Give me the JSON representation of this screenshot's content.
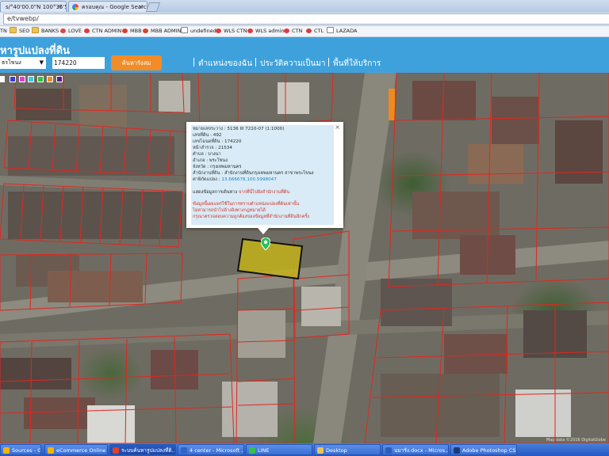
{
  "browser": {
    "tabs": [
      {
        "label": "s/°40'00.0\"N 100°35'59.3\"E"
      },
      {
        "label": "ครอบคุณ - Google Search"
      }
    ],
    "address": "e/tvwebp/"
  },
  "bookmarks": [
    {
      "label": "TN",
      "icon": "page-icon"
    },
    {
      "label": "SEO",
      "icon": "folder-icon"
    },
    {
      "label": "BANKS",
      "icon": "folder-icon"
    },
    {
      "label": "LOVE",
      "icon": "heart-icon"
    },
    {
      "label": "CTN ADMIN",
      "icon": "ctn-icon"
    },
    {
      "label": "MBB",
      "icon": "settings-icon"
    },
    {
      "label": "MBB ADMIN",
      "icon": "settings-icon"
    },
    {
      "label": "undefined",
      "icon": "page-icon"
    },
    {
      "label": "WLS CTN",
      "icon": "ctn-icon"
    },
    {
      "label": "WLS admin",
      "icon": "ctn-icon"
    },
    {
      "label": "CTN",
      "icon": "ctn-icon"
    },
    {
      "label": "CTL",
      "icon": "plane-icon"
    },
    {
      "label": "LAZADA",
      "icon": "page-icon"
    }
  ],
  "app": {
    "title": "หารูปแปลงที่ดิน",
    "province_value": "ธรโขนง",
    "parcel_value": "174220",
    "search_label": "ค้นหารังสม",
    "nav": [
      "ตำแหน่งของฉัน",
      "ประวัติความเป็นมา",
      "พื้นที่ให้บริการ"
    ]
  },
  "palette": [
    "#3b3bd9",
    "#e03fcf",
    "#3ec7e6",
    "#2fbf3f",
    "#f08a1e",
    "#5b1a8f"
  ],
  "popup": {
    "lines": [
      {
        "k": "หมายเลขระวาง :",
        "v": "5136 III 7210-07 (1:1000)"
      },
      {
        "k": "เลขที่ดิน :",
        "v": "492"
      },
      {
        "k": "เลขโฉนดที่ดิน :",
        "v": "174220"
      },
      {
        "k": "หน้าสำรวจ :",
        "v": "21534"
      },
      {
        "k": "ตำบล :",
        "v": "บางนา"
      },
      {
        "k": "อำเภอ :",
        "v": "พระโขนง"
      },
      {
        "k": "จังหวัด :",
        "v": "กรุงเทพมหานคร"
      },
      {
        "k": "สำนักงานที่ดิน :",
        "v": "สำนักงานที่ดินกรุงเทพมหานคร สาขาพระโขนง"
      },
      {
        "k": "ค่าพิกัดแปลง :",
        "v": "13.666678,100.5998047"
      }
    ],
    "source_prefix": "แสดงข้อมูลการเดินทาง",
    "source_link": "จากที่นี่ไปยังสำนักงานที่ดิน",
    "disclaimer": [
      "ข้อมูลนี้เผยแพร่ใช้ในการทราบตำแหน่งแปลงที่ดินเท่านั้น",
      "ไม่สามารถนำไปอ้างอิงทางกฎหมายได้",
      "กรุณาตรวจสอบความถูกต้องของข้อมูลที่สำนักงานที่ดินอีกครั้ง"
    ],
    "close": "×"
  },
  "map_attribution": "Map data ©2016 DigitalGlobe",
  "taskbar": [
    {
      "label": "Sources - Goo...",
      "color": "#f4b400"
    },
    {
      "label": "eCommerce Online ...",
      "color": "#f4b400"
    },
    {
      "label": "ระบบค้นหารูปแปลงที่ดิ...",
      "color": "#e04030"
    },
    {
      "label": "4 center - Microsoft ...",
      "color": "#2f65c8"
    },
    {
      "label": "LINE",
      "color": "#33c24a"
    },
    {
      "label": "Desktop",
      "color": "#e8c45a"
    },
    {
      "label": "นมารัง.docx - Micros...",
      "color": "#2a5fb8"
    },
    {
      "label": "Adobe Photoshop CS5",
      "color": "#1b3a78"
    }
  ]
}
